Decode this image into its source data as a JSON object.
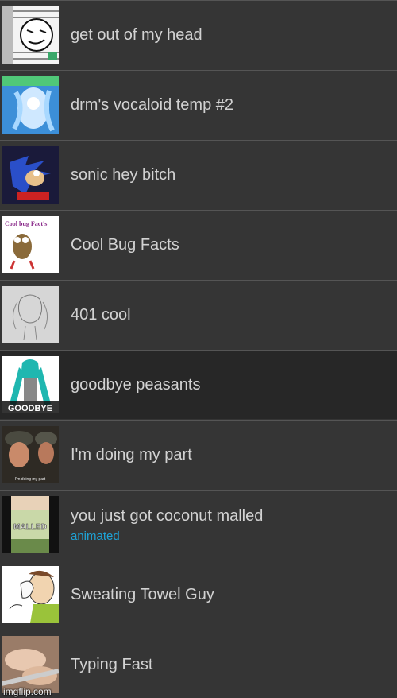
{
  "templates": [
    {
      "name": "get out of my head",
      "thumb_icon": "meme-scribble-face-thumbnail"
    },
    {
      "name": "drm's vocaloid temp #2",
      "thumb_icon": "vocaloid-anime-thumbnail"
    },
    {
      "name": "sonic hey bitch",
      "thumb_icon": "sonic-thumbnail"
    },
    {
      "name": "Cool Bug Facts",
      "thumb_icon": "cool-bug-facts-thumbnail",
      "thumb_text": "Cool bug Fact's"
    },
    {
      "name": "401 cool",
      "thumb_icon": "pencil-sketch-thumbnail"
    },
    {
      "name": "goodbye peasants",
      "thumb_icon": "miku-thumbnail",
      "thumb_text": "GOODBYE",
      "selected": true
    },
    {
      "name": "I'm doing my part",
      "thumb_icon": "soldiers-thumbnail",
      "thumb_text": "I'm doing my part"
    },
    {
      "name": "you just got coconut malled",
      "subtitle": "animated",
      "thumb_icon": "coconut-mall-thumbnail",
      "thumb_text": "MALLED"
    },
    {
      "name": "Sweating Towel Guy",
      "thumb_icon": "sweating-towel-guy-thumbnail"
    },
    {
      "name": "Typing Fast",
      "thumb_icon": "typing-hands-thumbnail"
    }
  ],
  "watermark": "imgflip.com",
  "colors": {
    "background": "#353535",
    "selected_row": "#272727",
    "divider": "#555555",
    "label": "#d2d2d2",
    "tag": "#1ea3d6"
  }
}
